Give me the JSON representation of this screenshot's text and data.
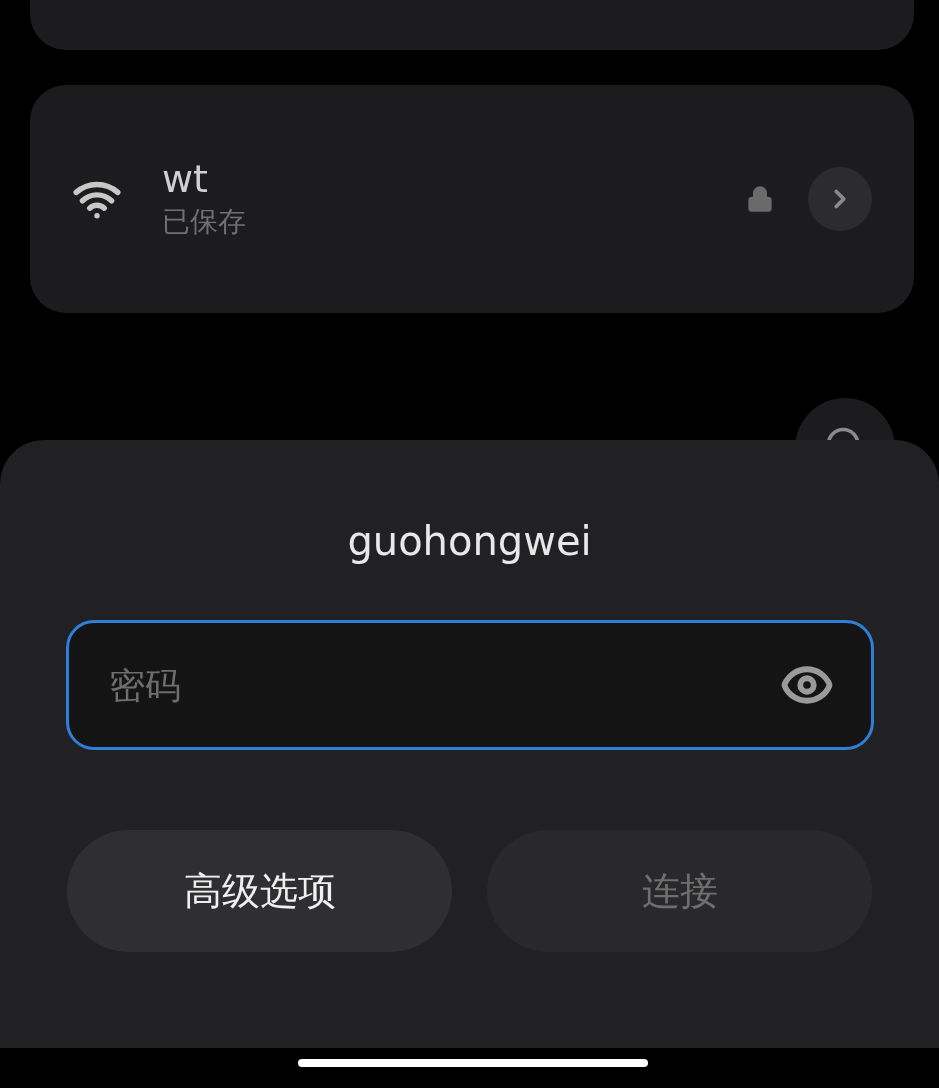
{
  "saved_network": {
    "name": "wt",
    "status": "已保存"
  },
  "dialog": {
    "title": "guohongwei",
    "password_field": {
      "placeholder": "密码",
      "focused": true
    },
    "buttons": [
      {
        "label": "高级选项",
        "disabled": false
      },
      {
        "label": "连接",
        "disabled": true
      }
    ]
  }
}
